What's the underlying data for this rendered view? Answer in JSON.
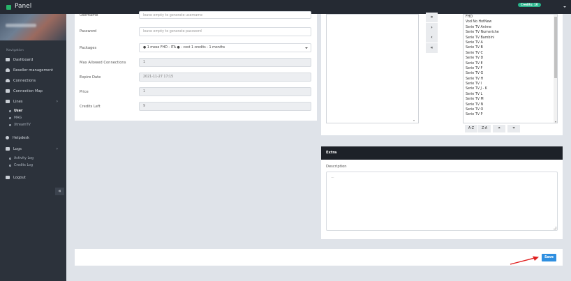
{
  "app": {
    "title": "Panel",
    "credits_badge": "Credits: 10"
  },
  "sidebar": {
    "heading": "Navigation",
    "items": [
      {
        "label": "Dashboard",
        "icon": "monitor-icon"
      },
      {
        "label": "Reseller management",
        "icon": "users-icon"
      },
      {
        "label": "Connections",
        "icon": "users-icon"
      },
      {
        "label": "Connection Map",
        "icon": "map-icon"
      },
      {
        "label": "Lines",
        "icon": "list-icon"
      },
      {
        "label": "Helpdesk",
        "icon": "support-icon"
      },
      {
        "label": "Logs",
        "icon": "list-icon"
      },
      {
        "label": "Logout",
        "icon": "logout-icon"
      }
    ],
    "lines_sub": [
      "User",
      "MAG",
      "XtreamTV"
    ],
    "logs_sub": [
      "Activity Log",
      "Credits Log"
    ],
    "collapse_glyph": "«"
  },
  "form": {
    "username_label": "Username",
    "username_placeholder": "leave empty to generate username",
    "password_label": "Password",
    "password_placeholder": "leave empty to generate password",
    "packages_label": "Packages",
    "packages_value": "● 1 mese FHD - ITA ● - cost 1 credits - 1 months",
    "max_conn_label": "Max Allowed Connections",
    "max_conn_value": "1",
    "expire_label": "Expire Date",
    "expire_value": "2021-11-27 17:15",
    "price_label": "Price",
    "price_value": "1",
    "credits_left_label": "Credits Left",
    "credits_left_value": "9"
  },
  "bouquets": {
    "movers": [
      "»",
      "›",
      "‹",
      "«"
    ],
    "selected": [
      "FHD",
      "Vod No HotNew",
      "Serie TV Anime",
      "Serie TV Numeriche",
      "Serie TV Bambini",
      "Serie TV A",
      "Serie TV B",
      "Serie TV C",
      "Serie TV D",
      "Serie TV E",
      "Serie TV F",
      "Serie TV G",
      "Serie TV H",
      "Serie TV I",
      "Serie TV J - K",
      "Serie TV L",
      "Serie TV M",
      "Serie TV N",
      "Serie TV O",
      "Serie TV P"
    ],
    "sort_az": "A-Z",
    "sort_za": "Z-A",
    "move_up": "⏶",
    "move_down": "⏷"
  },
  "extra": {
    "header": "Extra",
    "description_label": "Description",
    "description_placeholder": "..."
  },
  "footer": {
    "save_label": "Save"
  },
  "colors": {
    "accent": "#2f8fe0",
    "brand": "#27b36a",
    "sidebar": "#2c323b",
    "annotation_arrow": "#e02020"
  }
}
